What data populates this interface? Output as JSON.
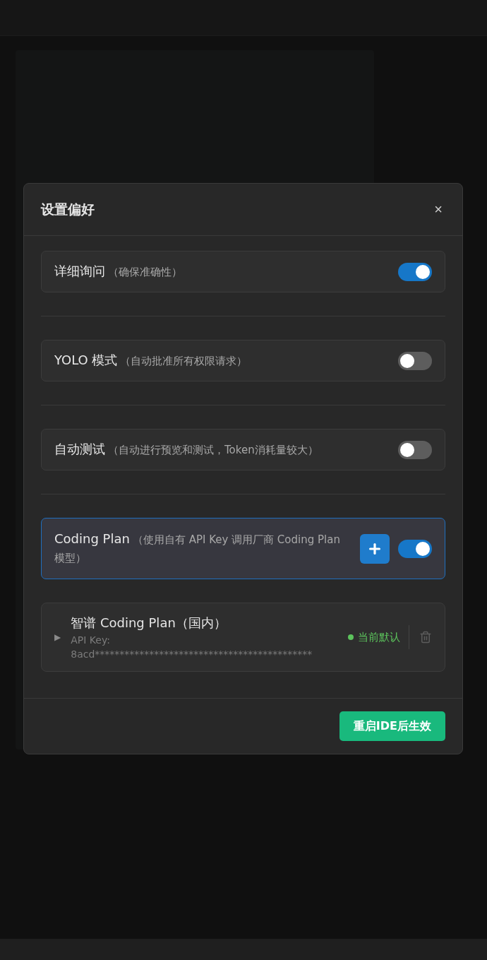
{
  "dialog": {
    "title": "设置偏好",
    "close": "×"
  },
  "settings": [
    {
      "kind": "toggle",
      "label": "详细询问",
      "hint": "（确保准确性）",
      "on": true
    },
    {
      "kind": "toggle",
      "label": "YOLO 模式",
      "hint": "（自动批准所有权限请求）",
      "on": false
    },
    {
      "kind": "toggle",
      "label": "自动测试",
      "hint": "（自动进行预览和测试，Token消耗量较大）",
      "on": false
    },
    {
      "kind": "plan",
      "label": "Coding Plan",
      "hint": "（使用自有 API Key 调用厂商 Coding Plan 模型）",
      "on": true
    }
  ],
  "providers": [
    {
      "expand_icon": "▶",
      "name": "智谱 Coding Plan（国内）",
      "key_label": "API Key:",
      "key": "8acd********************************************",
      "status": "当前默认",
      "color": "#5cc35c",
      "expanded": false
    }
  ],
  "footer": {
    "button": "重启IDE后生效"
  }
}
